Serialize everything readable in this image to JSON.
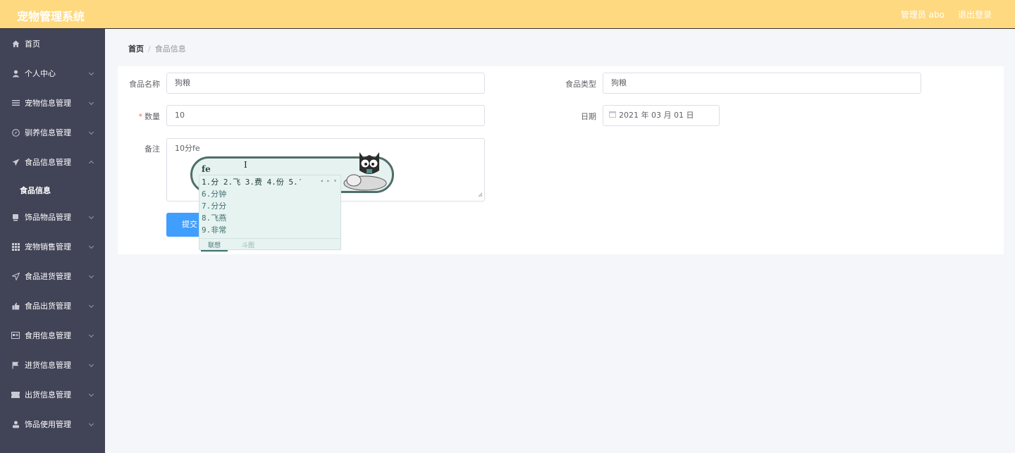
{
  "header": {
    "title": "宠物管理系统",
    "user_label": "管理员 abo",
    "logout_label": "退出登录"
  },
  "sidebar": {
    "items": [
      {
        "label": "首页",
        "icon": "home-icon",
        "expandable": false
      },
      {
        "label": "个人中心",
        "icon": "user-icon",
        "expandable": true
      },
      {
        "label": "宠物信息管理",
        "icon": "list-icon",
        "expandable": true
      },
      {
        "label": "驯养信息管理",
        "icon": "compass-icon",
        "expandable": true
      },
      {
        "label": "食品信息管理",
        "icon": "paper-plane-icon",
        "expandable": true,
        "expanded": true
      },
      {
        "label": "饰品物品管理",
        "icon": "box-icon",
        "expandable": true
      },
      {
        "label": "宠物销售管理",
        "icon": "grid-icon",
        "expandable": true
      },
      {
        "label": "食品进货管理",
        "icon": "send-icon",
        "expandable": true
      },
      {
        "label": "食品出货管理",
        "icon": "thumb-icon",
        "expandable": true
      },
      {
        "label": "食用信息管理",
        "icon": "card-icon",
        "expandable": true
      },
      {
        "label": "进货信息管理",
        "icon": "flag-icon",
        "expandable": true
      },
      {
        "label": "出货信息管理",
        "icon": "ticket-icon",
        "expandable": true
      },
      {
        "label": "饰品使用管理",
        "icon": "person-icon",
        "expandable": true
      }
    ],
    "submenu_active": "食品信息"
  },
  "breadcrumb": {
    "home": "首页",
    "separator": "/",
    "current": "食品信息"
  },
  "form": {
    "food_name_label": "食品名称",
    "food_name_value": "狗粮",
    "food_type_label": "食品类型",
    "food_type_value": "狗粮",
    "quantity_required": "*",
    "quantity_label": "数量",
    "quantity_value": "10",
    "date_label": "日期",
    "date_value": "2021 年 03 月 01 日",
    "remark_label": "备注",
    "remark_value": "10分fe",
    "submit_label": "提交"
  },
  "ime": {
    "typed": "fe",
    "row1": "1.分  2.飞  3.费  4.份  5.′",
    "candidates": [
      "6.分钟",
      "7.分分",
      "8.飞燕",
      "9.非常"
    ],
    "tab_active": "联想",
    "tab_other": "斗图"
  },
  "colors": {
    "header_bg": "#ffd97f",
    "sidebar_bg": "#414357",
    "primary": "#409eff",
    "page_bg": "#f4f6fa"
  }
}
